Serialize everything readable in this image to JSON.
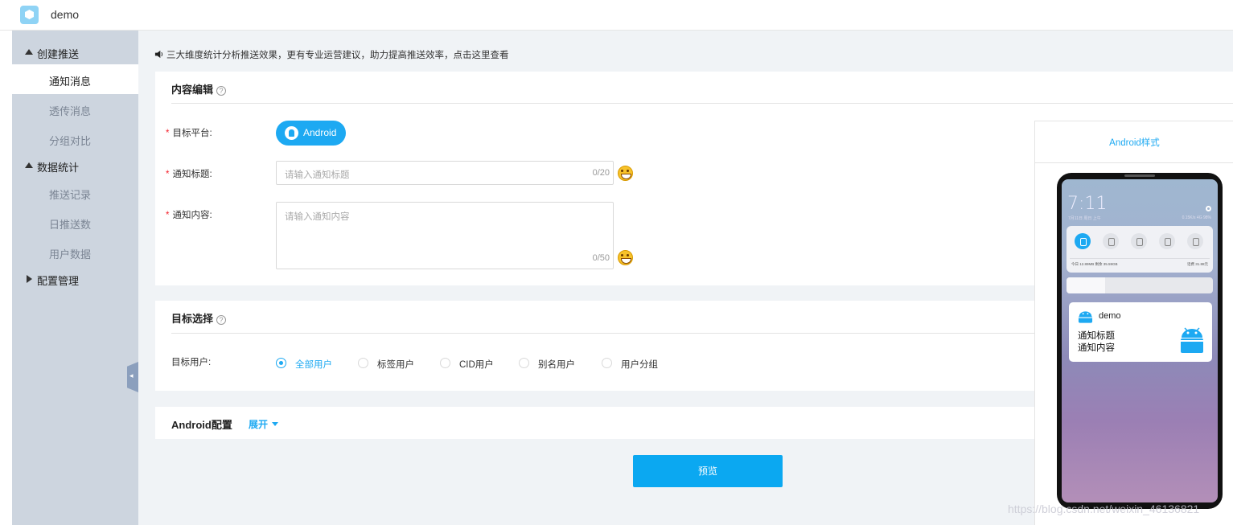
{
  "app": {
    "title": "demo"
  },
  "sidebar": {
    "groups": [
      {
        "label": "创建推送",
        "items": [
          "通知消息",
          "透传消息",
          "分组对比"
        ]
      },
      {
        "label": "数据统计",
        "items": [
          "推送记录",
          "日推送数",
          "用户数据"
        ]
      },
      {
        "label": "配置管理",
        "items": []
      }
    ],
    "active_item": "通知消息"
  },
  "notice": {
    "text": "三大维度统计分析推送效果，更有专业运营建议，助力提高推送效率，点击这里查看"
  },
  "content_edit": {
    "title": "内容编辑",
    "help_glyph": "?",
    "platform": {
      "label": "目标平台:",
      "button": "Android"
    },
    "notif_title": {
      "label": "通知标题:",
      "placeholder": "请输入通知标题",
      "count": "0/20"
    },
    "notif_content": {
      "label": "通知内容:",
      "placeholder": "请输入通知内容",
      "count": "0/50"
    },
    "required_mark": "*"
  },
  "target": {
    "title": "目标选择",
    "help_glyph": "?",
    "label": "目标用户:",
    "options": [
      "全部用户",
      "标签用户",
      "CID用户",
      "别名用户",
      "用户分组"
    ],
    "selected": "全部用户"
  },
  "android_config": {
    "title": "Android配置",
    "expand_label": "展开"
  },
  "actions": {
    "preview_label": "预览"
  },
  "preview": {
    "title": "Android样式",
    "phone": {
      "time": "7:11",
      "date": "7月11日 周日 上午",
      "status": "0.15K/s 4G 98%",
      "usage_left": "今日 12.89MB 剩余 35.59GB",
      "usage_right": "话费 31.88元",
      "notification": {
        "app": "demo",
        "title": "通知标题",
        "content": "通知内容"
      }
    }
  },
  "watermark": "https://blog.csdn.net/weixin_46136821",
  "colors": {
    "accent": "#1da9f2",
    "sidebar_bg": "#cdd5df",
    "main_bg": "#f0f3f6",
    "required": "#f5222d"
  }
}
